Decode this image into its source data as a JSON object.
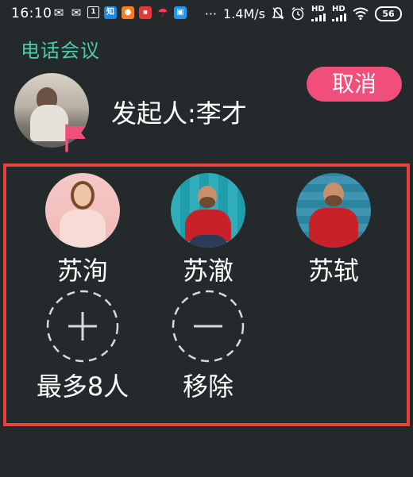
{
  "status_bar": {
    "time": "16:10",
    "more": "···",
    "speed": "1.4M/s",
    "hd1": "HD",
    "hd2": "HD",
    "battery": "56",
    "notif_zhi": "知",
    "notif_box": "1"
  },
  "app": {
    "title": "电话会议"
  },
  "initiator": {
    "label": "发起人:李才"
  },
  "cancel_button": {
    "label": "取消",
    "color": "#ef4f7a"
  },
  "members": [
    {
      "name": "苏洵"
    },
    {
      "name": "苏澈"
    },
    {
      "name": "苏轼"
    }
  ],
  "actions": {
    "add_label": "最多8人",
    "remove_label": "移除"
  },
  "colors": {
    "background": "#24292b",
    "title": "#4ec9ae",
    "panel_border": "#e8403b",
    "flag": "#ef4f7a"
  },
  "icons": {
    "flag": "flag-icon",
    "add": "plus-circle-icon",
    "remove": "minus-circle-icon"
  }
}
